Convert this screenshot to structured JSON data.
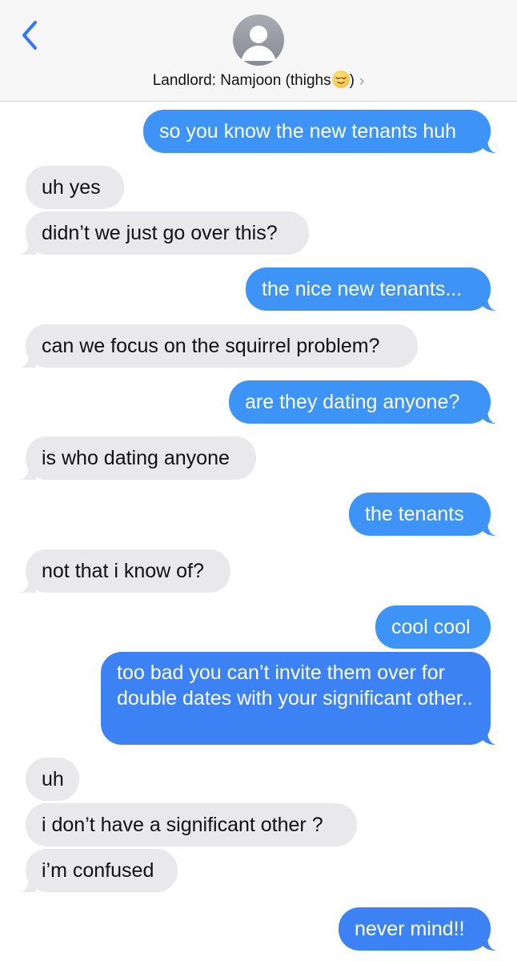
{
  "header": {
    "contact_name": "Landlord: Namjoon (thighs",
    "contact_suffix": ")",
    "emoji": "relieved-face-emoji",
    "chevron": "›"
  },
  "messages": [
    {
      "from": "me",
      "text": "so you know the new tenants huh"
    },
    {
      "from": "them",
      "text": "uh yes"
    },
    {
      "from": "them",
      "text": "didn’t we just go over this?"
    },
    {
      "from": "me",
      "text": "the nice new tenants..."
    },
    {
      "from": "them",
      "text": "can we focus on the squirrel problem?"
    },
    {
      "from": "me",
      "text": "are they dating anyone?"
    },
    {
      "from": "them",
      "text": "is who dating anyone"
    },
    {
      "from": "me",
      "text": "the tenants"
    },
    {
      "from": "them",
      "text": "not that i know of?"
    },
    {
      "from": "me",
      "text": "cool cool"
    },
    {
      "from": "me",
      "text": "too bad you can’t invite them over for double dates with your significant other.."
    },
    {
      "from": "them",
      "text": "uh"
    },
    {
      "from": "them",
      "text": "i don’t have a significant other ?"
    },
    {
      "from": "them",
      "text": "i’m confused"
    },
    {
      "from": "me",
      "text": "never mind!!"
    }
  ],
  "colors": {
    "outgoing_bubble": "#3d94f6",
    "incoming_bubble": "#e9e9eb",
    "accent": "#3478f6"
  }
}
